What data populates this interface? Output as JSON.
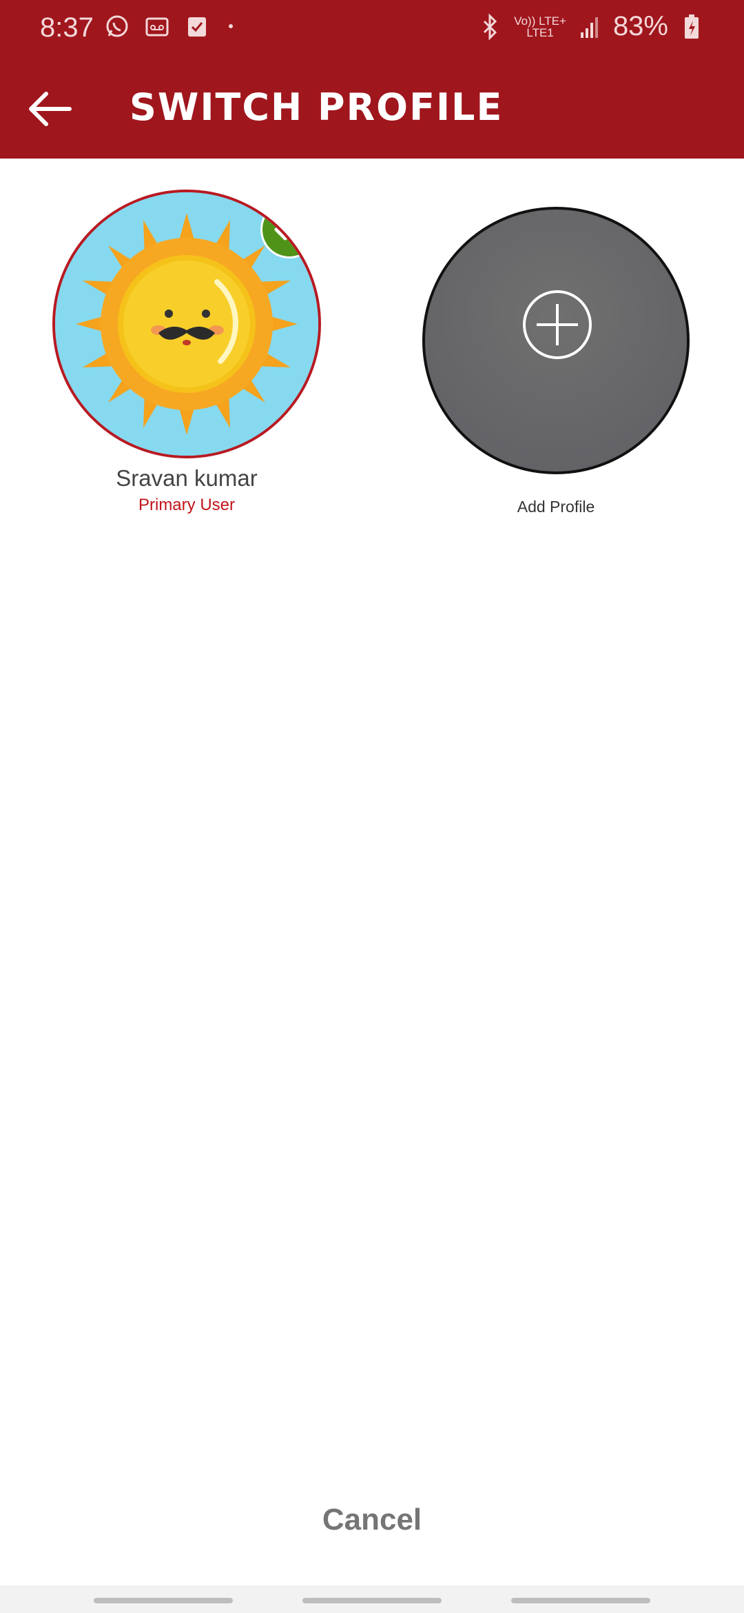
{
  "status_bar": {
    "time": "8:37",
    "network_top": "Vo)) LTE+",
    "network_bottom": "LTE1",
    "battery": "83%",
    "left_icons": [
      "whatsapp-icon",
      "voicemail-icon",
      "task-check-icon"
    ],
    "right_icons": [
      "bluetooth-icon",
      "signal-icon",
      "battery-charging-icon"
    ]
  },
  "header": {
    "title": "SWITCH PROFILE",
    "back_icon": "arrow-left-icon",
    "color": "#a0161d"
  },
  "profiles": [
    {
      "name": "Sravan kumar",
      "role": "Primary User",
      "selected": true,
      "avatar": "sun-mustache-avatar"
    }
  ],
  "add_profile": {
    "label": "Add Profile",
    "icon": "plus-circle-icon"
  },
  "footer": {
    "cancel_label": "Cancel"
  },
  "colors": {
    "accent": "#a0161d",
    "selected_badge": "#4f9418",
    "role_text": "#c0141b"
  }
}
